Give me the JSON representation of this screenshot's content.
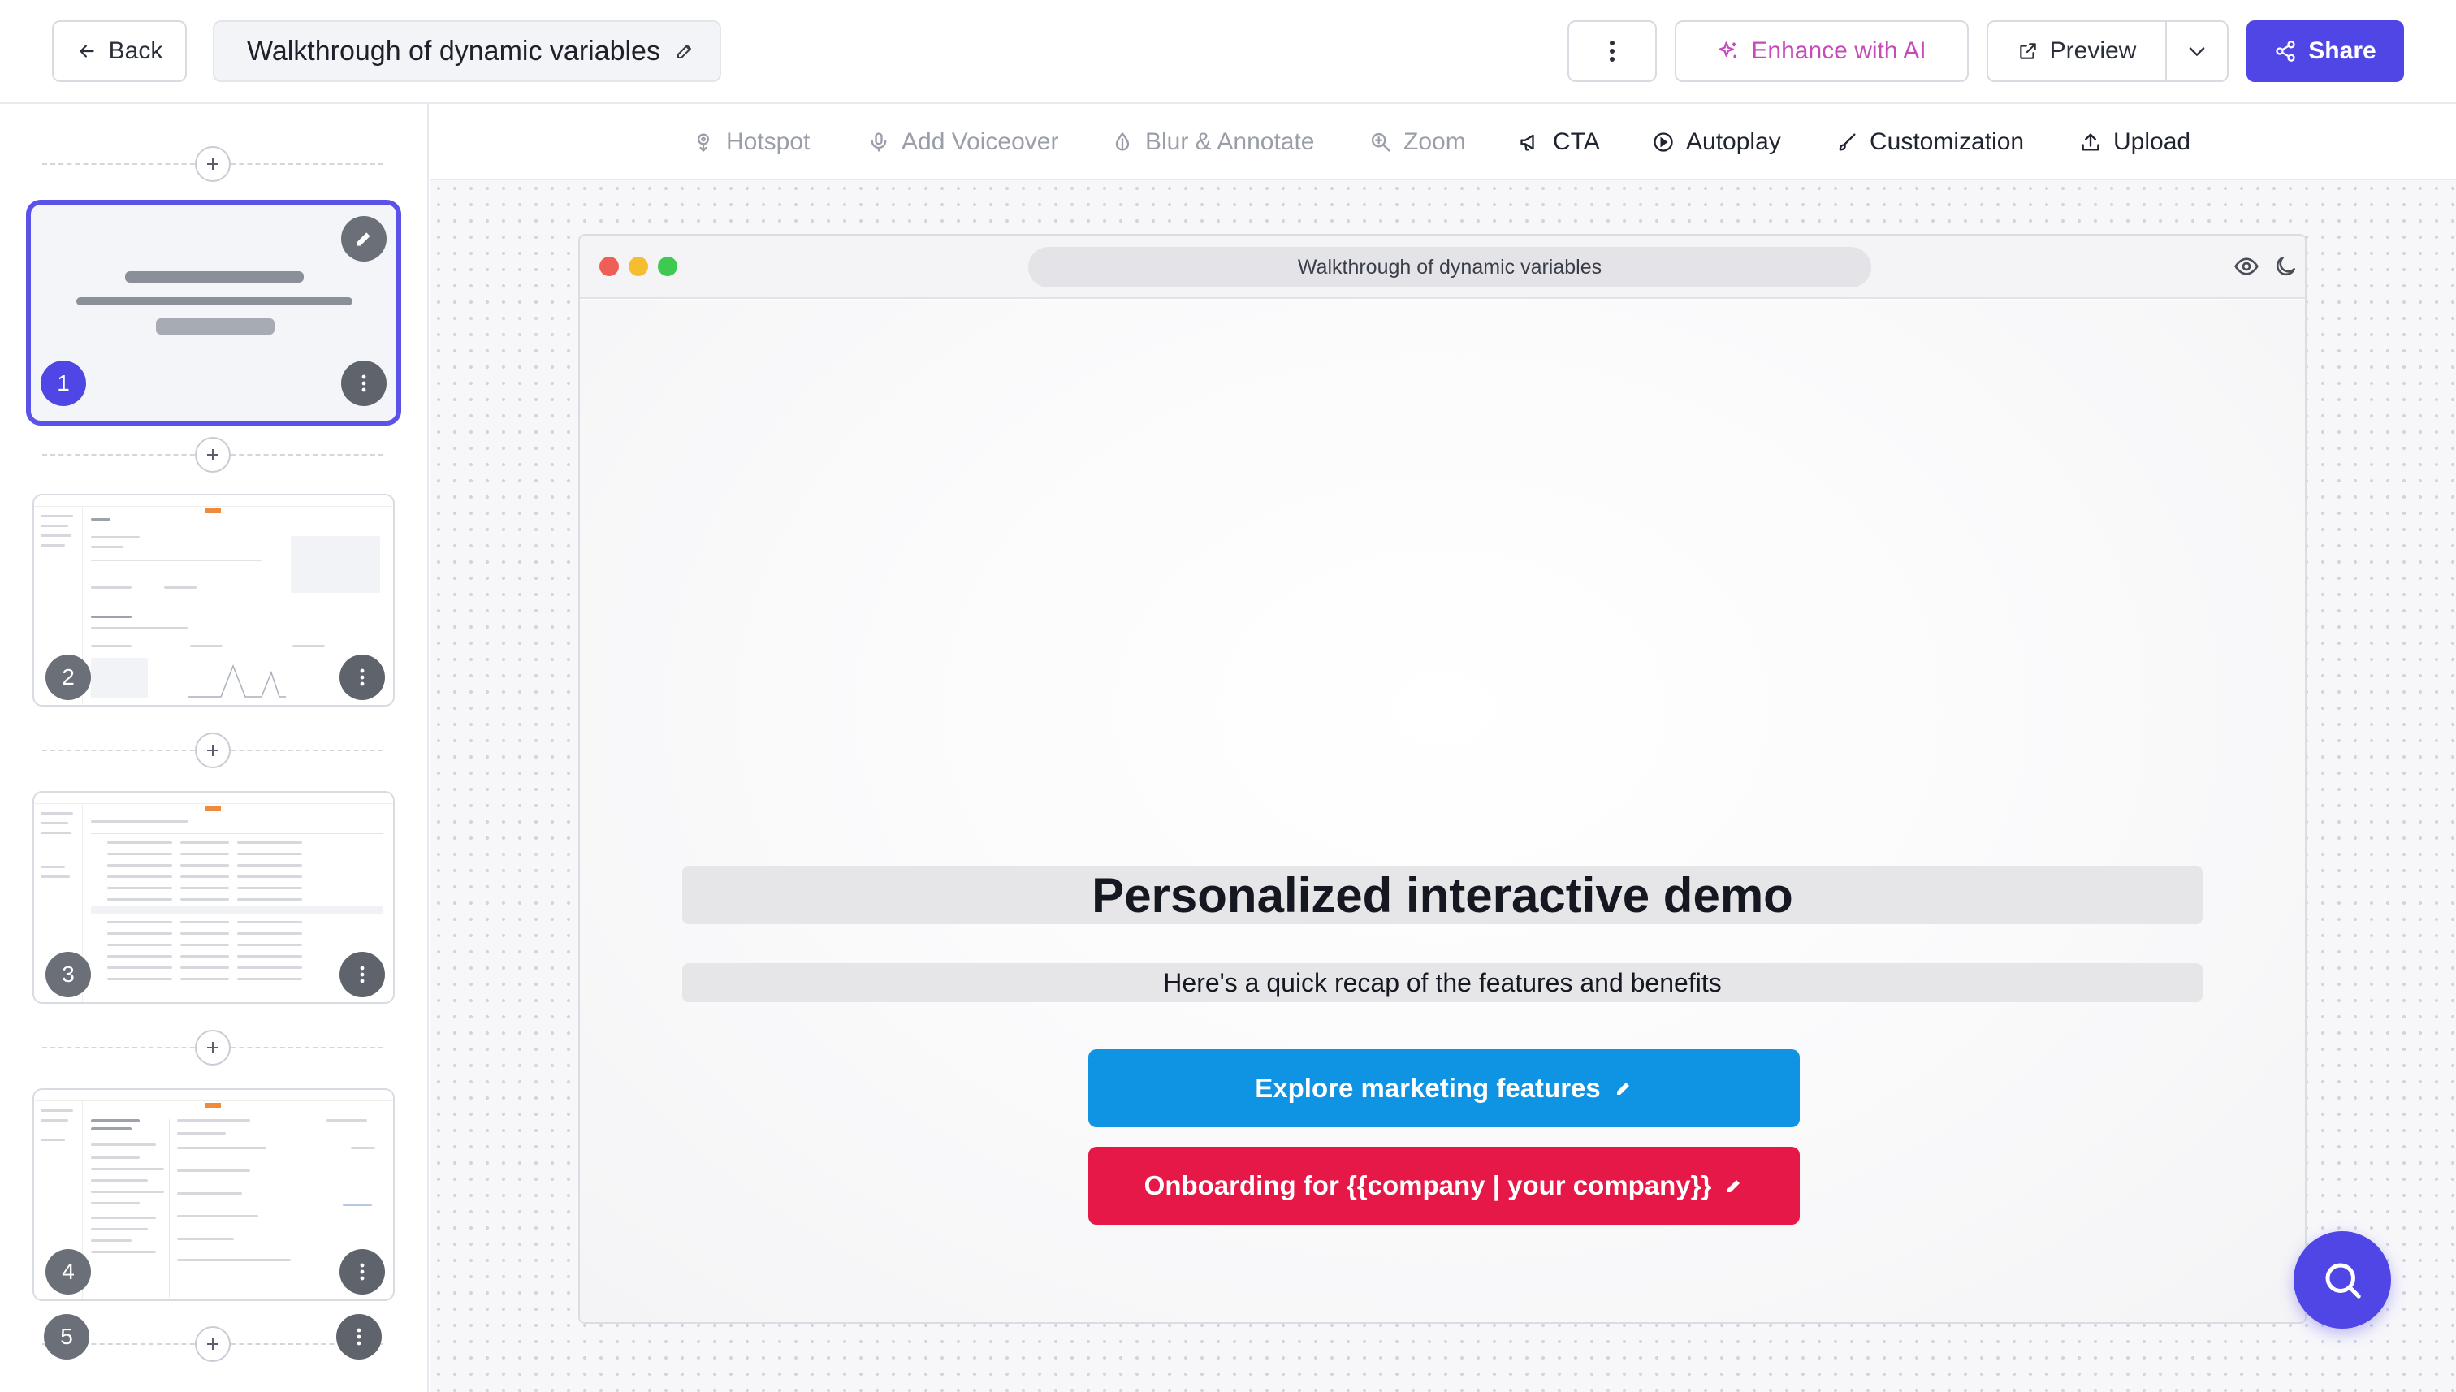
{
  "header": {
    "back_label": "Back",
    "title": "Walkthrough of dynamic variables",
    "enhance_label": "Enhance with AI",
    "preview_label": "Preview",
    "share_label": "Share"
  },
  "toolbar": {
    "items": [
      {
        "label": "Hotspot",
        "icon": "hotspot-icon",
        "enabled": false
      },
      {
        "label": "Add Voiceover",
        "icon": "microphone-icon",
        "enabled": false
      },
      {
        "label": "Blur & Annotate",
        "icon": "blur-icon",
        "enabled": false
      },
      {
        "label": "Zoom",
        "icon": "zoom-icon",
        "enabled": false
      },
      {
        "label": "CTA",
        "icon": "megaphone-icon",
        "enabled": true
      },
      {
        "label": "Autoplay",
        "icon": "play-icon",
        "enabled": true
      },
      {
        "label": "Customization",
        "icon": "brush-icon",
        "enabled": true
      },
      {
        "label": "Upload",
        "icon": "upload-icon",
        "enabled": true
      }
    ]
  },
  "sidebar": {
    "slides": [
      {
        "number": "1",
        "active": true
      },
      {
        "number": "2",
        "active": false
      },
      {
        "number": "3",
        "active": false
      },
      {
        "number": "4",
        "active": false
      },
      {
        "number": "5",
        "active": false
      }
    ]
  },
  "demo": {
    "window_title": "Walkthrough of dynamic variables",
    "headline": "Personalized interactive demo",
    "subheadline": "Here's a quick recap of the features and benefits",
    "cta_primary": "Explore marketing features",
    "cta_secondary": "Onboarding for {{company | your company}}"
  },
  "colors": {
    "accent": "#4f46e5",
    "enhance": "#c54bb8",
    "cta_blue": "#0f93e3",
    "cta_red": "#e61847"
  }
}
